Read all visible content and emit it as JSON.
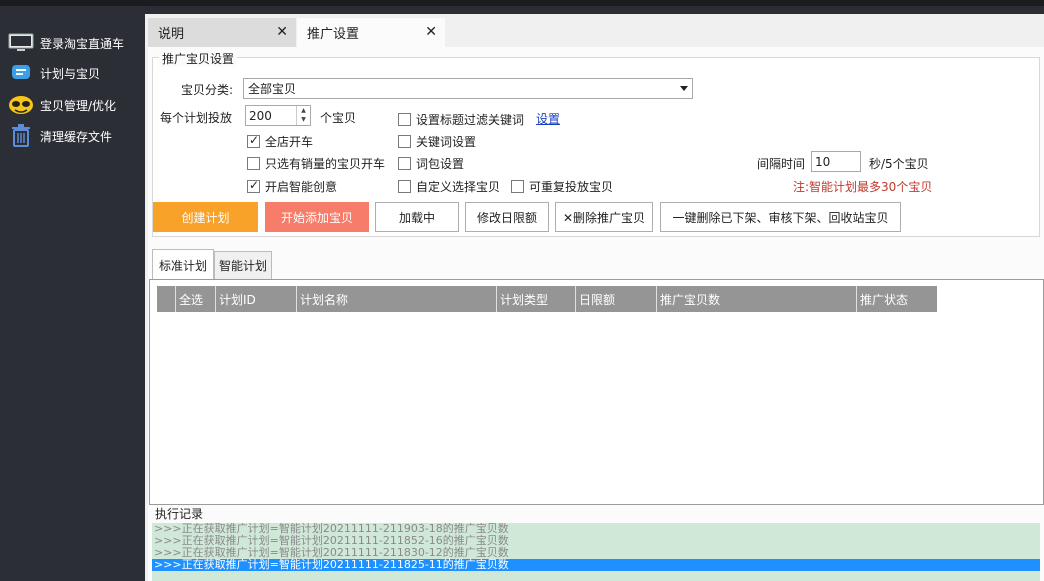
{
  "sidebar": {
    "items": [
      {
        "label": "登录淘宝直通车",
        "icon": "monitor-icon"
      },
      {
        "label": "计划与宝贝",
        "icon": "chat-icon"
      },
      {
        "label": "宝贝管理/优化",
        "icon": "sunglasses-icon"
      },
      {
        "label": "清理缓存文件",
        "icon": "trash-icon"
      }
    ]
  },
  "tabs": [
    {
      "label": "说明",
      "close": "✕"
    },
    {
      "label": "推广设置",
      "close": "✕"
    }
  ],
  "settings": {
    "group_title": "推广宝贝设置",
    "category_label": "宝贝分类:",
    "category_value": "全部宝贝",
    "per_plan_label": "每个计划投放",
    "per_plan_value": "200",
    "per_plan_unit": "个宝贝",
    "whole_store": "全店开车",
    "only_sales": "只选有销量的宝贝开车",
    "smart_creative": "开启智能创意",
    "title_filter": "设置标题过滤关键词",
    "title_filter_link": "设置",
    "keyword_settings": "关键词设置",
    "wordpack_settings": "词包设置",
    "custom_select": "自定义选择宝贝",
    "repeat_items": "可重复投放宝贝",
    "interval_label": "间隔时间",
    "interval_value": "10",
    "interval_unit": "秒/5个宝贝",
    "note": "注:智能计划最多30个宝贝"
  },
  "buttons": {
    "create_plan": "创建计划",
    "start_add": "开始添加宝贝",
    "loading": "加载中",
    "edit_limit": "修改日限额",
    "delete_items": "✕删除推广宝贝",
    "one_click_delete": "一键删除已下架、审核下架、回收站宝贝"
  },
  "subtabs": [
    "标准计划",
    "智能计划"
  ],
  "grid": {
    "columns": [
      "全选",
      "计划ID",
      "计划名称",
      "计划类型",
      "日限额",
      "推广宝贝数",
      "推广状态"
    ]
  },
  "log": {
    "title": "执行记录",
    "lines": [
      ">>>正在获取推广计划=智能计划20211111-211903-18的推广宝贝数",
      ">>>正在获取推广计划=智能计划20211111-211852-16的推广宝贝数",
      ">>>正在获取推广计划=智能计划20211111-211830-12的推广宝贝数",
      ">>>正在获取推广计划=智能计划20211111-211825-11的推广宝贝数"
    ]
  }
}
